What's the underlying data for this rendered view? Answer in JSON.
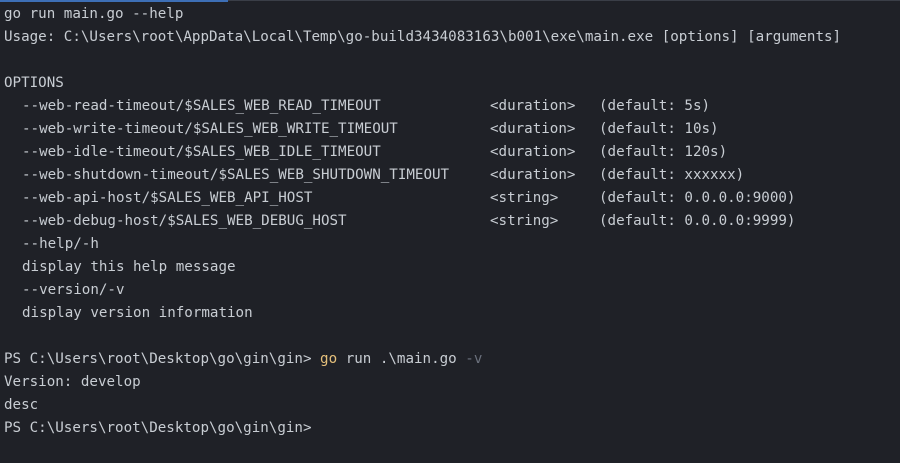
{
  "terminal": {
    "command_line": "go run main.go --help",
    "usage_line": "Usage: C:\\Users\\root\\AppData\\Local\\Temp\\go-build3434083163\\b001\\exe\\main.exe [options] [arguments]",
    "options_header": "OPTIONS",
    "options": [
      {
        "flag": "--web-read-timeout/$SALES_WEB_READ_TIMEOUT",
        "type": "<duration>",
        "default": "(default: 5s)"
      },
      {
        "flag": "--web-write-timeout/$SALES_WEB_WRITE_TIMEOUT",
        "type": "<duration>",
        "default": "(default: 10s)"
      },
      {
        "flag": "--web-idle-timeout/$SALES_WEB_IDLE_TIMEOUT",
        "type": "<duration>",
        "default": "(default: 120s)"
      },
      {
        "flag": "--web-shutdown-timeout/$SALES_WEB_SHUTDOWN_TIMEOUT",
        "type": "<duration>",
        "default": "(default: xxxxxx)"
      },
      {
        "flag": "--web-api-host/$SALES_WEB_API_HOST",
        "type": "<string>",
        "default": "(default: 0.0.0.0:9000)"
      },
      {
        "flag": "--web-debug-host/$SALES_WEB_DEBUG_HOST",
        "type": "<string>",
        "default": "(default: 0.0.0.0:9999)"
      }
    ],
    "help_flag": "--help/-h",
    "help_desc": "display this help message",
    "version_flag": "--version/-v",
    "version_desc": "display version information",
    "prompt": "PS C:\\Users\\root\\Desktop\\go\\gin\\gin>",
    "second_command": {
      "go": "go",
      "rest": "run .\\main.go",
      "flag": "-v"
    },
    "version_output": "Version: develop",
    "desc_output": "desc",
    "final_prompt": "PS C:\\Users\\root\\Desktop\\go\\gin\\gin>"
  },
  "colors": {
    "background": "#1f2127",
    "text": "#c8cdd3",
    "command_highlight": "#e5c07b",
    "flag_dim": "#6b717d"
  }
}
